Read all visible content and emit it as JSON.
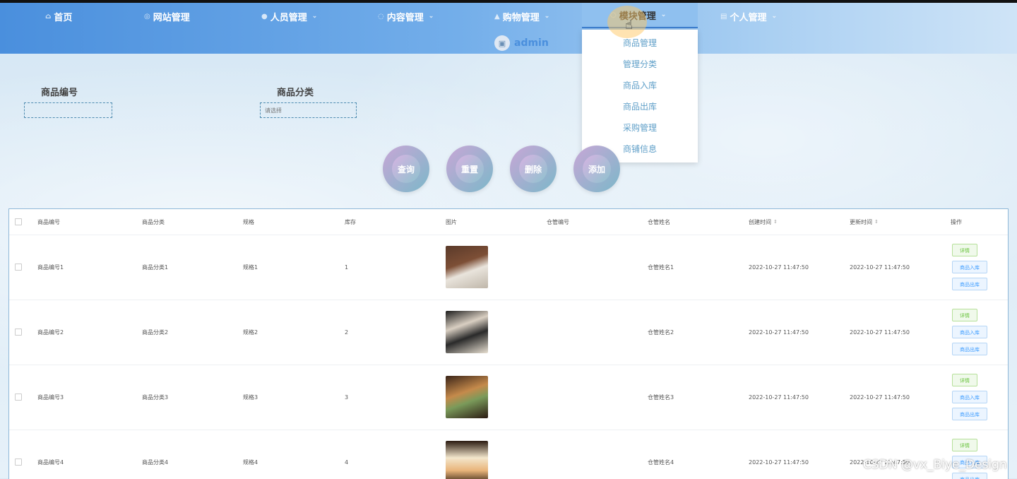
{
  "nav": {
    "items": [
      {
        "label": "首页",
        "icon": "home-icon",
        "dropdown": false
      },
      {
        "label": "网站管理",
        "icon": "globe-icon",
        "dropdown": false
      },
      {
        "label": "人员管理",
        "icon": "user-icon",
        "dropdown": true
      },
      {
        "label": "内容管理",
        "icon": "chat-icon",
        "dropdown": true
      },
      {
        "label": "购物管理",
        "icon": "cart-icon",
        "dropdown": true
      },
      {
        "label": "模块管理",
        "icon": "module-icon",
        "dropdown": true,
        "active": true
      },
      {
        "label": "个人管理",
        "icon": "document-icon",
        "dropdown": true
      }
    ],
    "user": "admin",
    "dropdown_items": [
      "商品管理",
      "管理分类",
      "商品入库",
      "商品出库",
      "采购管理",
      "商铺信息"
    ]
  },
  "search": {
    "field1_label": "商品编号",
    "field2_label": "商品分类",
    "field2_placeholder": "请选择"
  },
  "buttons": {
    "query": "查询",
    "reset": "重置",
    "delete": "删除",
    "add": "添加"
  },
  "table": {
    "columns": [
      "商品编号",
      "商品分类",
      "规格",
      "库存",
      "图片",
      "仓管编号",
      "仓管姓名",
      "创建时间",
      "更新时间",
      "操作"
    ],
    "rows": [
      {
        "code": "商品编号1",
        "category": "商品分类1",
        "spec": "规格1",
        "stock": "1",
        "keeper_no": "",
        "keeper_name": "仓管姓名1",
        "created": "2022-10-27 11:47:50",
        "updated": "2022-10-27 11:47:50"
      },
      {
        "code": "商品编号2",
        "category": "商品分类2",
        "spec": "规格2",
        "stock": "2",
        "keeper_no": "",
        "keeper_name": "仓管姓名2",
        "created": "2022-10-27 11:47:50",
        "updated": "2022-10-27 11:47:50"
      },
      {
        "code": "商品编号3",
        "category": "商品分类3",
        "spec": "规格3",
        "stock": "3",
        "keeper_no": "",
        "keeper_name": "仓管姓名3",
        "created": "2022-10-27 11:47:50",
        "updated": "2022-10-27 11:47:50"
      },
      {
        "code": "商品编号4",
        "category": "商品分类4",
        "spec": "规格4",
        "stock": "4",
        "keeper_no": "",
        "keeper_name": "仓管姓名4",
        "created": "2022-10-27 11:47:50",
        "updated": "2022-10-27 11:47:50"
      }
    ],
    "ops": {
      "detail": "详情",
      "stock_in": "商品入库",
      "stock_out": "商品出库"
    },
    "colors": {
      "detail": "#67c23a",
      "stock": "#409eff"
    }
  },
  "watermark": "CSDN @vx_Biye_Design"
}
